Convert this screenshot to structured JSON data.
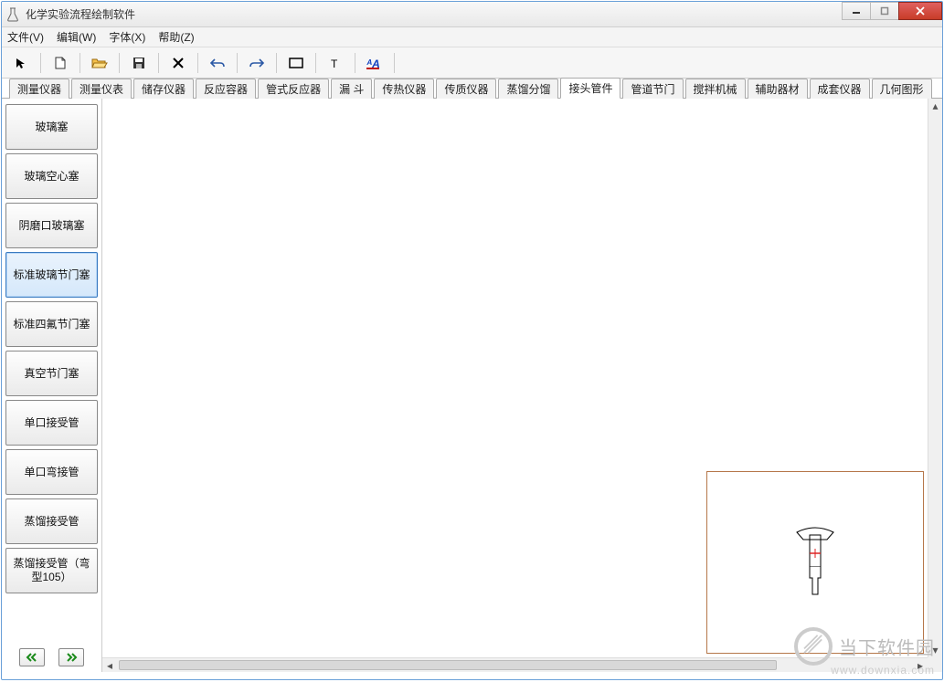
{
  "window": {
    "title": "化学实验流程绘制软件"
  },
  "menu": {
    "file": "文件(V)",
    "edit": "编辑(W)",
    "font": "字体(X)",
    "help": "帮助(Z)"
  },
  "toolbar": {
    "pointer": "pointer",
    "new": "new",
    "open": "open",
    "save": "save",
    "delete": "delete",
    "undo": "undo",
    "redo": "redo",
    "rect": "rect",
    "text": "text",
    "format": "format"
  },
  "categories": [
    "测量仪器",
    "测量仪表",
    "储存仪器",
    "反应容器",
    "管式反应器",
    "漏  斗",
    "传热仪器",
    "传质仪器",
    "蒸馏分馏",
    "接头管件",
    "管道节门",
    "搅拌机械",
    "辅助器材",
    "成套仪器",
    "几何图形"
  ],
  "active_category_index": 9,
  "shapes": [
    "玻璃塞",
    "玻璃空心塞",
    "阴磨口玻璃塞",
    "标准玻璃节门塞",
    "标准四氟节门塞",
    "真空节门塞",
    "单口接受管",
    "单口弯接管",
    "蒸馏接受管",
    "蒸馏接受管（弯型105）"
  ],
  "selected_shape_index": 3,
  "watermark": {
    "brand": "当下软件园",
    "url": "www.downxia.com"
  }
}
